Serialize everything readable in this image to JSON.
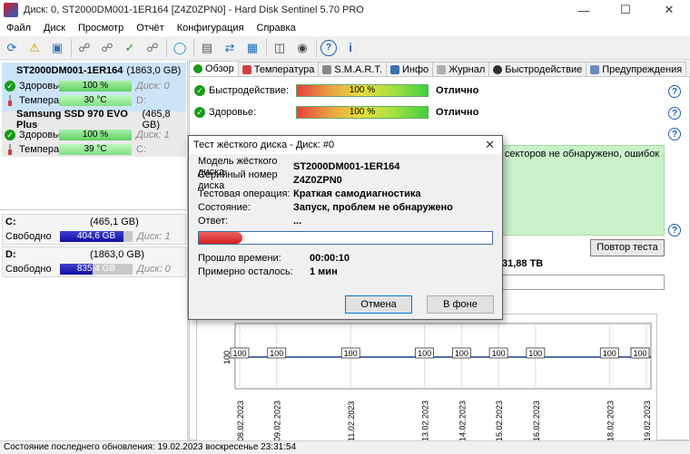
{
  "window": {
    "title": "Диск: 0, ST2000DM001-1ER164 [Z4Z0ZPN0]  -  Hard Disk Sentinel 5.70 PRO"
  },
  "menu": [
    "Файл",
    "Диск",
    "Просмотр",
    "Отчёт",
    "Конфигурация",
    "Справка"
  ],
  "toolbar_icons": [
    "refresh-icon",
    "alert-icon",
    "drive-icon",
    "satellite-icon",
    "satellite-icon",
    "satellite-check-icon",
    "satellite-icon",
    "globe-icon",
    "document-icon",
    "sync-icon",
    "network-icon",
    "monitor-icon",
    "speaker-icon",
    "help-icon",
    "info-icon"
  ],
  "disks": [
    {
      "name": "ST2000DM001-1ER164",
      "size": "(1863,0 GB)",
      "health_label": "Здоровье:",
      "health": "100 %",
      "health_disk": "Диск: 0",
      "temp_label": "Температура:",
      "temp": "30 °C",
      "drive_letter": "D:"
    },
    {
      "name": "Samsung SSD 970 EVO Plus",
      "size": "(465,8 GB)",
      "health_label": "Здоровье:",
      "health": "100 %",
      "health_disk": "Диск: 1",
      "temp_label": "Температура:",
      "temp": "39 °C",
      "drive_letter": "C:"
    }
  ],
  "volumes": [
    {
      "letter": "C:",
      "size": "(465,1 GB)",
      "free_label": "Свободно",
      "free": "404,6 GB",
      "disk": "Диск: 1",
      "free_fraction": 0.87
    },
    {
      "letter": "D:",
      "size": "(1863,0 GB)",
      "free_label": "Свободно",
      "free": "835,4 GB",
      "disk": "Диск: 0",
      "free_fraction": 0.45
    }
  ],
  "tabs": [
    "Обзор",
    "Температура",
    "S.M.A.R.T.",
    "Инфо",
    "Журнал",
    "Быстродействие",
    "Предупреждения"
  ],
  "overview": {
    "perf_label": "Быстродействие:",
    "perf_value": "100 %",
    "perf_rating": "Отлично",
    "health_label": "Здоровье:",
    "health_value": "100 %",
    "health_rating": "Отлично",
    "info_text": "Жёсткий диск в ОТЛИЧНОМ состоянии. Проблемных или слабых секторов не обнаружено, ошибок раскрутки и",
    "retest_label": "Повтор теста",
    "tb_value": "31,88 TB"
  },
  "chart": {
    "value_labels": [
      "100",
      "100",
      "100",
      "100",
      "100",
      "100",
      "100",
      "100",
      "100",
      "100"
    ],
    "y_tick": "100",
    "x_dates": [
      "08.02.2023",
      "09.02.2023",
      "11.02.2023",
      "13.02.2023",
      "14.02.2023",
      "15.02.2023",
      "16.02.2023",
      "18.02.2023",
      "19.02.2023"
    ]
  },
  "chart_data": {
    "type": "line",
    "x": [
      "08.02.2023",
      "09.02.2023",
      "11.02.2023",
      "13.02.2023",
      "14.02.2023",
      "15.02.2023",
      "16.02.2023",
      "18.02.2023",
      "19.02.2023"
    ],
    "series": [
      {
        "values": [
          100,
          100,
          100,
          100,
          100,
          100,
          100,
          100,
          100
        ]
      }
    ]
  },
  "dialog": {
    "title": "Тест жёсткого диска - Диск: #0",
    "rows": [
      {
        "k": "Модель жёсткого диска",
        "v": "ST2000DM001-1ER164"
      },
      {
        "k": "Серийный номер диска",
        "v": "Z4Z0ZPN0"
      },
      {
        "k": "Тестовая операция:",
        "v": "Краткая самодиагностика"
      },
      {
        "k": "Состояние:",
        "v": "Запуск, проблем не обнаружено"
      },
      {
        "k": "Ответ:",
        "v": "..."
      }
    ],
    "progress_fraction": 0.15,
    "elapsed_label": "Прошло времени:",
    "elapsed": "00:00:10",
    "remaining_label": "Примерно осталось:",
    "remaining": "1 мин",
    "cancel": "Отмена",
    "background": "В фоне"
  },
  "status": "Состояние последнего обновления: 19.02.2023 воскресенье 23:31:54"
}
